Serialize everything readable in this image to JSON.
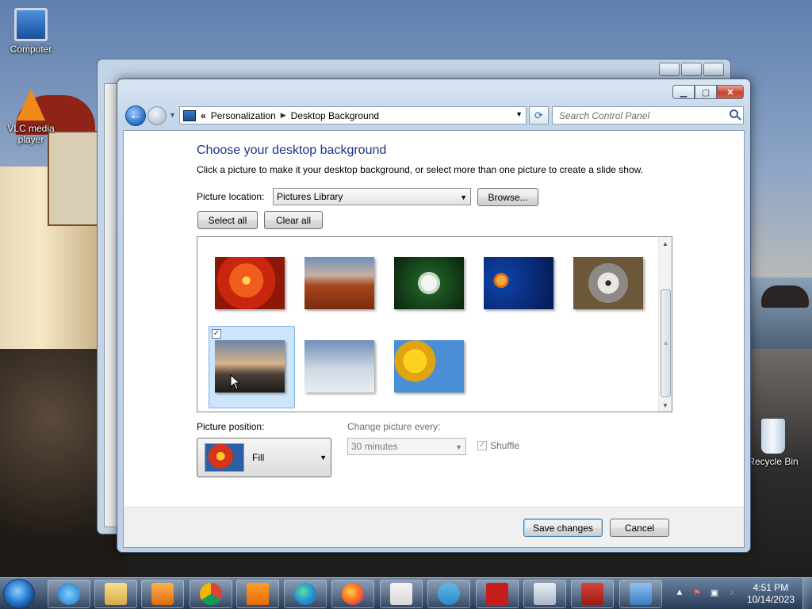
{
  "desktop": {
    "icons": [
      {
        "label": "Computer"
      },
      {
        "label": "VLC media player"
      },
      {
        "label": "Recycle Bin"
      }
    ]
  },
  "window": {
    "breadcrumb": [
      "Personalization",
      "Desktop Background"
    ],
    "search_placeholder": "Search Control Panel",
    "title": "Choose your desktop background",
    "description": "Click a picture to make it your desktop background, or select more than one picture to create a slide show.",
    "picture_location_label": "Picture location:",
    "picture_location_value": "Pictures Library",
    "browse_label": "Browse...",
    "select_all_label": "Select all",
    "clear_all_label": "Clear all",
    "thumbnails": [
      {
        "name": "orange-flower",
        "selected": false
      },
      {
        "name": "desert-mesa",
        "selected": false
      },
      {
        "name": "white-hydrangea",
        "selected": false
      },
      {
        "name": "jellyfish",
        "selected": false
      },
      {
        "name": "koala",
        "selected": false
      },
      {
        "name": "lighthouse",
        "selected": true
      },
      {
        "name": "penguins",
        "selected": false
      },
      {
        "name": "tulips",
        "selected": false
      }
    ],
    "picture_position_label": "Picture position:",
    "picture_position_value": "Fill",
    "change_every_label": "Change picture every:",
    "change_every_value": "30 minutes",
    "shuffle_label": "Shuffle",
    "shuffle_checked": true,
    "shuffle_enabled": false,
    "save_label": "Save changes",
    "cancel_label": "Cancel"
  },
  "taskbar": {
    "apps": [
      "internet-explorer",
      "file-explorer",
      "media-player",
      "chrome",
      "vlc",
      "edge",
      "firefox",
      "java",
      "telegram",
      "ole-tool",
      "calculator",
      "toolbox",
      "control-panel"
    ],
    "time": "4:51 PM",
    "date": "10/14/2023"
  }
}
